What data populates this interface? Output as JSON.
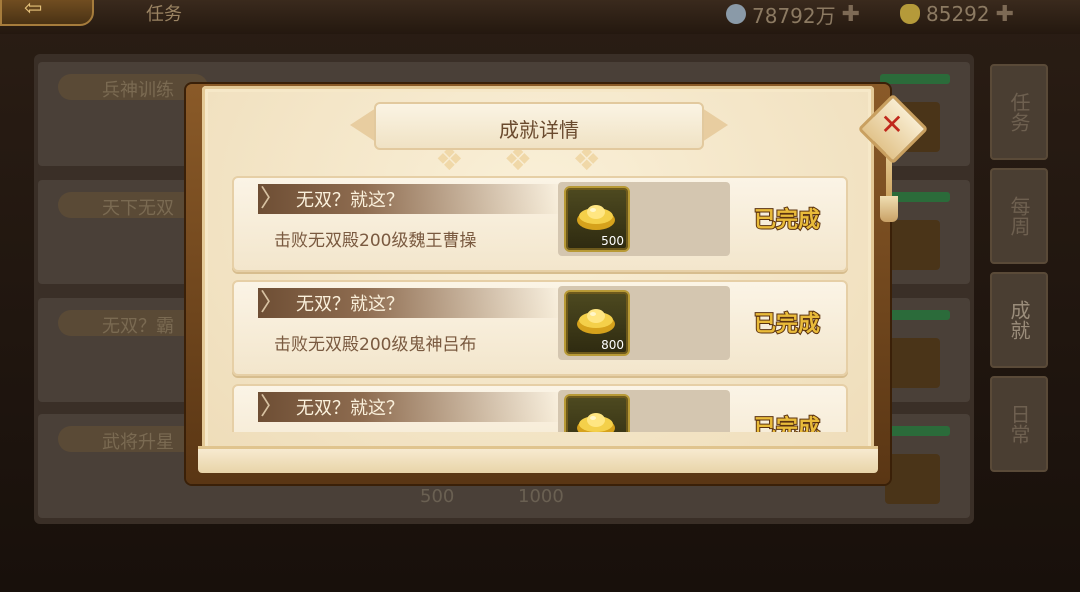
{
  "topbar": {
    "back_symbol": "⇦",
    "title": "任务",
    "silver_value": "78792万",
    "gold_value": "85292",
    "plus_symbol": "✚"
  },
  "background_list": [
    {
      "label": "兵神训练"
    },
    {
      "label": "天下无双"
    },
    {
      "label": "无双？霸"
    },
    {
      "label": "武将升星"
    }
  ],
  "background_costs": [
    "500",
    "1000"
  ],
  "side_tabs": [
    {
      "label": "任务",
      "active": false
    },
    {
      "label": "每周",
      "active": false
    },
    {
      "label": "成就",
      "active": true
    },
    {
      "label": "日常",
      "active": false
    }
  ],
  "modal": {
    "title": "成就详情",
    "close_symbol": "✕",
    "achievements": [
      {
        "name": "无双？就这？",
        "desc": "击败无双殿200级魏王曹操",
        "reward_icon": "gold-ingot-icon",
        "reward_qty": "500",
        "status": "已完成"
      },
      {
        "name": "无双？就这？",
        "desc": "击败无双殿200级鬼神吕布",
        "reward_icon": "gold-ingot-icon",
        "reward_qty": "800",
        "status": "已完成"
      },
      {
        "name": "无双？就这？",
        "desc": "",
        "reward_icon": "gold-ingot-icon",
        "reward_qty": "",
        "status": "已完成"
      }
    ]
  },
  "colors": {
    "status_gold": "#e9bb3a",
    "close_red": "#c0281c",
    "card_bg": "#fbf4e6"
  }
}
